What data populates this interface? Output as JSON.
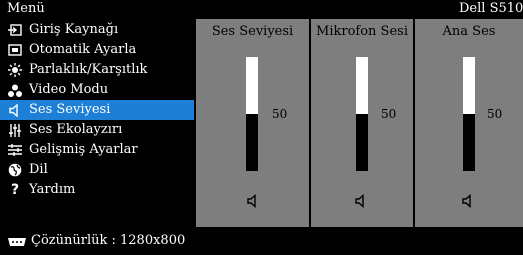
{
  "header": {
    "title": "Menü",
    "model": "Dell S510"
  },
  "menu": {
    "items": [
      {
        "label": "Giriş Kaynağı",
        "icon": "input-source-icon"
      },
      {
        "label": "Otomatik Ayarla",
        "icon": "auto-adjust-icon"
      },
      {
        "label": "Parlaklık/Karşıtlık",
        "icon": "brightness-icon"
      },
      {
        "label": "Video Modu",
        "icon": "video-mode-icon"
      },
      {
        "label": "Ses Seviyesi",
        "icon": "speaker-icon",
        "selected": true
      },
      {
        "label": "Ses Ekolayzırı",
        "icon": "equalizer-icon"
      },
      {
        "label": "Gelişmiş Ayarlar",
        "icon": "advanced-settings-icon"
      },
      {
        "label": "Dil",
        "icon": "language-icon"
      },
      {
        "label": "Yardım",
        "icon": "help-icon"
      }
    ]
  },
  "panels": [
    {
      "title": "Ses Seviyesi",
      "value": "50",
      "level": 0.5
    },
    {
      "title": "Mikrofon Sesi",
      "value": "50",
      "level": 0.5
    },
    {
      "title": "Ana Ses",
      "value": "50",
      "level": 0.5
    }
  ],
  "footer": {
    "resolution_text": "Çözünürlük : 1280x800",
    "icon": "connector-icon"
  },
  "colors": {
    "selected": "#1e7fd6",
    "panel": "#7e7e7e",
    "background": "#000000"
  }
}
